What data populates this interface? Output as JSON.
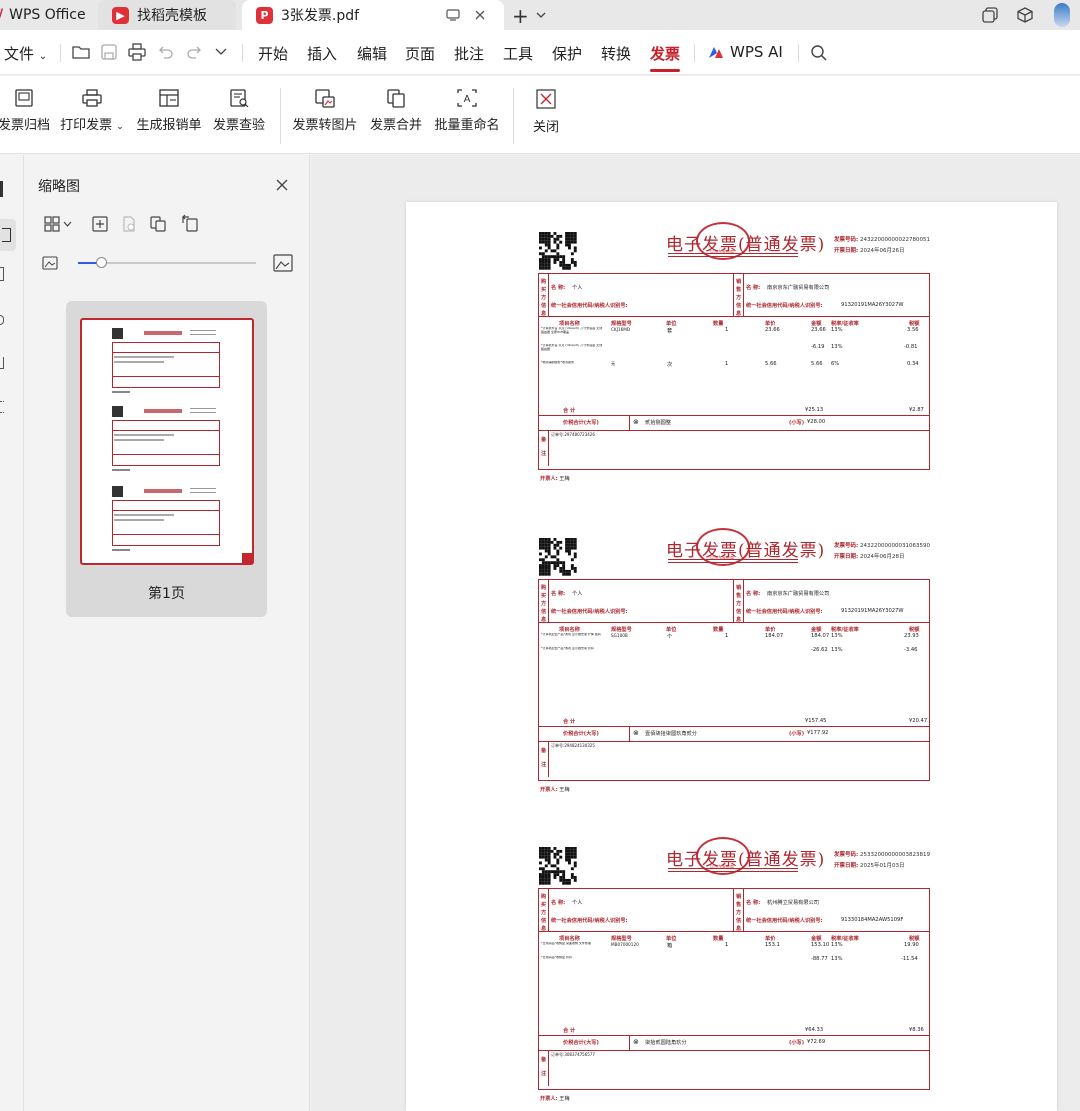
{
  "tabs": {
    "t1": "WPS Office",
    "t2": "找稻壳模板",
    "t3": "3张发票.pdf",
    "new_tab": "+"
  },
  "menu": {
    "file": "文件",
    "items": [
      "开始",
      "插入",
      "编辑",
      "页面",
      "批注",
      "工具",
      "保护",
      "转换",
      "发票"
    ],
    "ai": "WPS AI"
  },
  "ribbon": {
    "archive": "发票归档",
    "print": "打印发票",
    "reimburse": "生成报销单",
    "verify": "发票查验",
    "to_image": "发票转图片",
    "merge": "发票合并",
    "rename": "批量重命名",
    "close": "关闭"
  },
  "thumbs": {
    "title": "缩略图",
    "page1_label": "第1页"
  },
  "colors": {
    "accent": "#e0313a",
    "invoice_red": "#b0272f",
    "active_menu": "#c8202b"
  },
  "invoice_common": {
    "title": "电子发票(普通发票)",
    "stamp_text": "以京东家电商",
    "no_label": "发票号码:",
    "date_label": "开票日期:",
    "buyer_vlabel": "购买方信息",
    "seller_vlabel": "销售方信息",
    "name_label": "名 称:",
    "tax_label": "统一社会信用代码/纳税人识别号:",
    "h_item": "项目名称",
    "h_spec": "规格型号",
    "h_unit": "单位",
    "h_qty": "数量",
    "h_price": "单价",
    "h_amount": "金额",
    "h_rate": "税率/征收率",
    "h_tax": "税额",
    "total_label": "合   计",
    "sum_label": "价税合计(大写)",
    "small_label": "(小写)",
    "remark_vlabel": "备注",
    "drawer_label": "开票人:",
    "drawer_name": "王梅"
  },
  "invoices": [
    {
      "no": "24322000000022780051",
      "date": "2024年06月26日",
      "buyer": "个人",
      "seller": "南京京东广融贸易有限公司",
      "seller_tax": "91320191MA26Y3027W",
      "rows": [
        {
          "name": "*计算机外设 以及 (Ubiquiti) 八寸米底座 无线路由器 全屋WiFi覆盖",
          "spec": "CKJ16MD",
          "unit": "套",
          "qty": "1",
          "price": "23.66",
          "amount": "23.66",
          "rate": "13%",
          "tax": "3.56"
        },
        {
          "name": "*计算机外设 以及 (Ubiquiti) 八寸米底座 无线路由器",
          "spec": "",
          "unit": "",
          "qty": "",
          "price": "",
          "amount": "-6.19",
          "rate": "13%",
          "tax": "-0.81"
        },
        {
          "name": "*物流辅助服务*收派服务",
          "spec": "无",
          "unit": "次",
          "qty": "1",
          "price": "5.66",
          "amount": "5.66",
          "rate": "6%",
          "tax": "0.34"
        }
      ],
      "total_amount": "¥25.13",
      "total_tax": "¥2.87",
      "sum_words": "贰拾捌圆整",
      "sum_small": "¥28.00",
      "remark": "订单号:297480723426"
    },
    {
      "no": "24322000000031063590",
      "date": "2024年06月28日",
      "buyer": "个人",
      "seller": "南京京东广融贸易有限公司",
      "seller_tax": "91320191MA26Y3027W",
      "rows": [
        {
          "name": "*计算机配套产品*游戏 显示器支架 升降 旋转",
          "spec": "SG100B",
          "unit": "个",
          "qty": "1",
          "price": "184.07",
          "amount": "184.07",
          "rate": "13%",
          "tax": "23.93"
        },
        {
          "name": "*计算机配套产品*游戏 显示器支架 折扣",
          "spec": "",
          "unit": "",
          "qty": "",
          "price": "",
          "amount": "-26.62",
          "rate": "13%",
          "tax": "-3.46"
        }
      ],
      "total_amount": "¥157.45",
      "total_tax": "¥20.47",
      "sum_words": "壹佰柒拾柒圆玖角贰分",
      "sum_small": "¥177.92",
      "remark": "订单号:294824130325"
    },
    {
      "no": "25332000000003823819",
      "date": "2025年01月03日",
      "buyer": "个人",
      "seller": "杭州腾立贸易有限公司",
      "seller_tax": "91330184MA2AW5109F",
      "rows": [
        {
          "name": "*日用杂品*收纳盒 桌面收纳 文件整理",
          "spec": "MB07000120",
          "unit": "箱",
          "qty": "1",
          "price": "153.1",
          "amount": "153.10",
          "rate": "13%",
          "tax": "19.90"
        },
        {
          "name": "*日用杂品*收纳盒 折扣",
          "spec": "",
          "unit": "",
          "qty": "",
          "price": "",
          "amount": "-88.77",
          "rate": "13%",
          "tax": "-11.54"
        }
      ],
      "total_amount": "¥64.33",
      "total_tax": "¥8.36",
      "sum_words": "柒拾贰圆陆角玖分",
      "sum_small": "¥72.69",
      "remark": "订单号:308374756577"
    }
  ]
}
